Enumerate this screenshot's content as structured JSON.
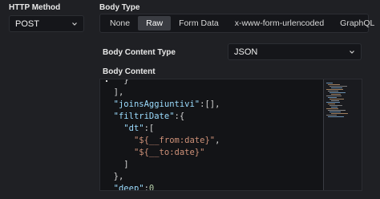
{
  "http_method": {
    "label": "HTTP Method",
    "value": "POST"
  },
  "body_type": {
    "label": "Body Type",
    "tabs": [
      {
        "label": "None",
        "active": false
      },
      {
        "label": "Raw",
        "active": true
      },
      {
        "label": "Form Data",
        "active": false
      },
      {
        "label": "x-www-form-urlencoded",
        "active": false
      },
      {
        "label": "GraphQL",
        "active": false
      }
    ]
  },
  "body_content_type": {
    "label": "Body Content Type",
    "value": "JSON"
  },
  "body_content": {
    "label": "Body Content",
    "lines": [
      {
        "indent": 4,
        "tokens": [
          {
            "t": "p",
            "v": "}"
          }
        ]
      },
      {
        "indent": 2,
        "tokens": [
          {
            "t": "p",
            "v": "],"
          }
        ]
      },
      {
        "indent": 2,
        "tokens": [
          {
            "t": "k",
            "v": "\"joinsAggiuntivi\""
          },
          {
            "t": "p",
            "v": ":[],"
          }
        ]
      },
      {
        "indent": 2,
        "tokens": [
          {
            "t": "k",
            "v": "\"filtriDate\""
          },
          {
            "t": "p",
            "v": ":{"
          }
        ]
      },
      {
        "indent": 4,
        "tokens": [
          {
            "t": "k",
            "v": "\"dt\""
          },
          {
            "t": "p",
            "v": ":["
          }
        ]
      },
      {
        "indent": 6,
        "tokens": [
          {
            "t": "s",
            "v": "\"${__from:date}\""
          },
          {
            "t": "p",
            "v": ","
          }
        ]
      },
      {
        "indent": 6,
        "tokens": [
          {
            "t": "s",
            "v": "\"${__to:date}\""
          }
        ]
      },
      {
        "indent": 4,
        "tokens": [
          {
            "t": "p",
            "v": "]"
          }
        ]
      },
      {
        "indent": 2,
        "tokens": [
          {
            "t": "p",
            "v": "},"
          }
        ]
      },
      {
        "indent": 2,
        "tokens": [
          {
            "t": "k",
            "v": "\"deep\""
          },
          {
            "t": "p",
            "v": ":"
          },
          {
            "t": "n",
            "v": "0"
          }
        ]
      },
      {
        "indent": 0,
        "tokens": [
          {
            "t": "p",
            "v": "}"
          }
        ]
      }
    ]
  },
  "icons": {
    "select_chevron": "chevron-down-icon"
  },
  "colors": {
    "background": "#1f2024",
    "input_background": "#15161a",
    "active_tab": "#3a3c42",
    "json_key": "#9cdcfe",
    "json_string": "#ce9178",
    "json_number": "#b5cea8"
  }
}
